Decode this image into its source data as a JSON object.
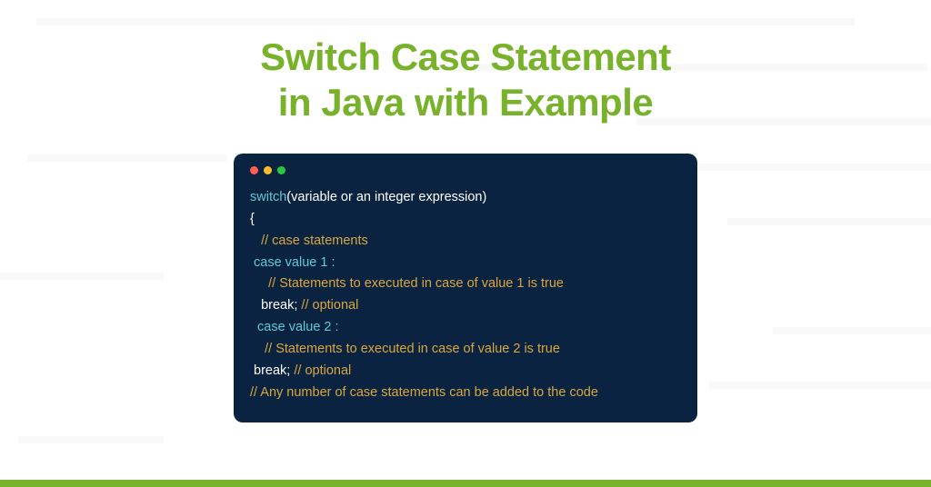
{
  "title_line1": "Switch Case Statement",
  "title_line2": "in Java with Example",
  "code": {
    "l1_kw": "switch",
    "l1_rest": "(variable or an integer expression)",
    "l2": "{",
    "l3": "   // case statements",
    "l4": " case value 1 :",
    "l5": "     // Statements to executed in case of value 1 is true",
    "l6a": "   break; ",
    "l6b": "// optional",
    "l7": "  case value 2 :",
    "l8": "    // Statements to executed in case of value 2 is true",
    "l9a": " break; ",
    "l9b": "// optional",
    "l10": "// Any number of case statements can be added to the code"
  }
}
